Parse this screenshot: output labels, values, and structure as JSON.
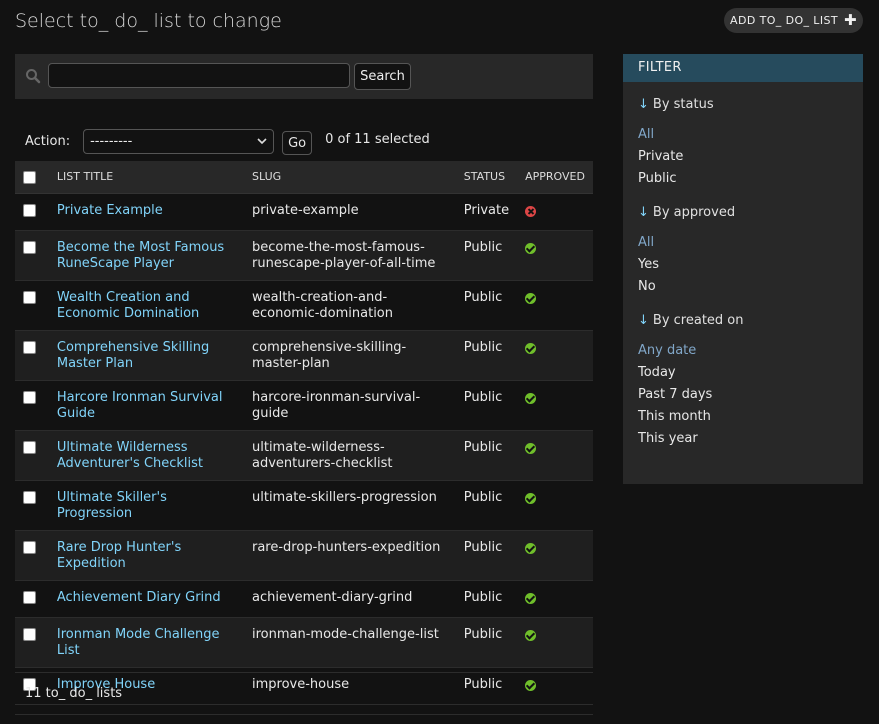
{
  "page": {
    "title": "Select to_ do_ list to change",
    "add_button": "ADD TO_ DO_ LIST"
  },
  "search": {
    "value": "",
    "placeholder": "",
    "button": "Search"
  },
  "actions": {
    "label": "Action:",
    "selected_option": "---------",
    "go": "Go",
    "selected_count": "0 of 11 selected"
  },
  "table": {
    "headers": [
      "LIST TITLE",
      "SLUG",
      "STATUS",
      "APPROVED"
    ],
    "rows": [
      {
        "title": "Private Example",
        "slug": "private-example",
        "status": "Private",
        "approved": false
      },
      {
        "title": "Become the Most Famous RuneScape Player",
        "slug": "become-the-most-famous-runescape-player-of-all-time",
        "status": "Public",
        "approved": true
      },
      {
        "title": "Wealth Creation and Economic Domination",
        "slug": "wealth-creation-and-economic-domination",
        "status": "Public",
        "approved": true
      },
      {
        "title": "Comprehensive Skilling Master Plan",
        "slug": "comprehensive-skilling-master-plan",
        "status": "Public",
        "approved": true
      },
      {
        "title": "Harcore Ironman Survival Guide",
        "slug": "harcore-ironman-survival-guide",
        "status": "Public",
        "approved": true
      },
      {
        "title": "Ultimate Wilderness Adventurer's Checklist",
        "slug": "ultimate-wilderness-adventurers-checklist",
        "status": "Public",
        "approved": true
      },
      {
        "title": "Ultimate Skiller's Progression",
        "slug": "ultimate-skillers-progression",
        "status": "Public",
        "approved": true
      },
      {
        "title": "Rare Drop Hunter's Expedition",
        "slug": "rare-drop-hunters-expedition",
        "status": "Public",
        "approved": true
      },
      {
        "title": "Achievement Diary Grind",
        "slug": "achievement-diary-grind",
        "status": "Public",
        "approved": true
      },
      {
        "title": "Ironman Mode Challenge List",
        "slug": "ironman-mode-challenge-list",
        "status": "Public",
        "approved": true
      },
      {
        "title": "Improve House",
        "slug": "improve-house",
        "status": "Public",
        "approved": true
      }
    ]
  },
  "paginator": {
    "text": "11 to_ do_ lists"
  },
  "filter": {
    "title": "FILTER",
    "groups": [
      {
        "title": "By status",
        "options": [
          "All",
          "Private",
          "Public"
        ],
        "selected": "All"
      },
      {
        "title": "By approved",
        "options": [
          "All",
          "Yes",
          "No"
        ],
        "selected": "All"
      },
      {
        "title": "By created on",
        "options": [
          "Any date",
          "Today",
          "Past 7 days",
          "This month",
          "This year"
        ],
        "selected": "Any date"
      }
    ]
  },
  "colors": {
    "link": "#81d4fa",
    "filter_header": "#264b5d",
    "yes": "#70bf2b",
    "no": "#dd4646"
  }
}
